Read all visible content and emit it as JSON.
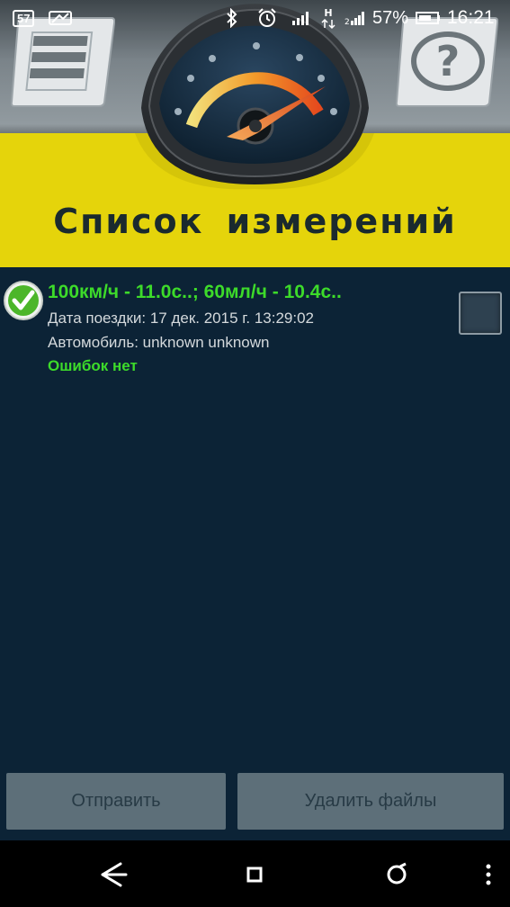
{
  "status_bar": {
    "notification_count": "57",
    "battery_percent": "57%",
    "time": "16:21",
    "icons": [
      "notification-icon",
      "image-icon",
      "bluetooth-icon",
      "alarm-icon",
      "signal-icon",
      "h-data-icon",
      "signal-icon",
      "battery-icon"
    ]
  },
  "header": {
    "title": "Список  измерений",
    "menu_icon": "menu-icon",
    "help_icon": "help-icon",
    "gauge_icon": "speedometer-icon"
  },
  "list": {
    "items": [
      {
        "title": "100км/ч - 11.0с..; 60мл/ч - 10.4с..",
        "date": "Дата поездки: 17 дек. 2015 г. 13:29:02",
        "car": "Автомобиль: unknown unknown",
        "status": "Ошибок нет",
        "checked": false
      }
    ]
  },
  "buttons": {
    "send": "Отправить",
    "delete": "Удалить файлы"
  },
  "nav": {
    "icons": [
      "back-icon",
      "home-icon",
      "recents-icon",
      "more-icon"
    ]
  },
  "colors": {
    "background": "#0c2336",
    "header_yellow": "#e5d40b",
    "accent_green": "#3ddb2a",
    "button_gray": "#5d6f79"
  }
}
